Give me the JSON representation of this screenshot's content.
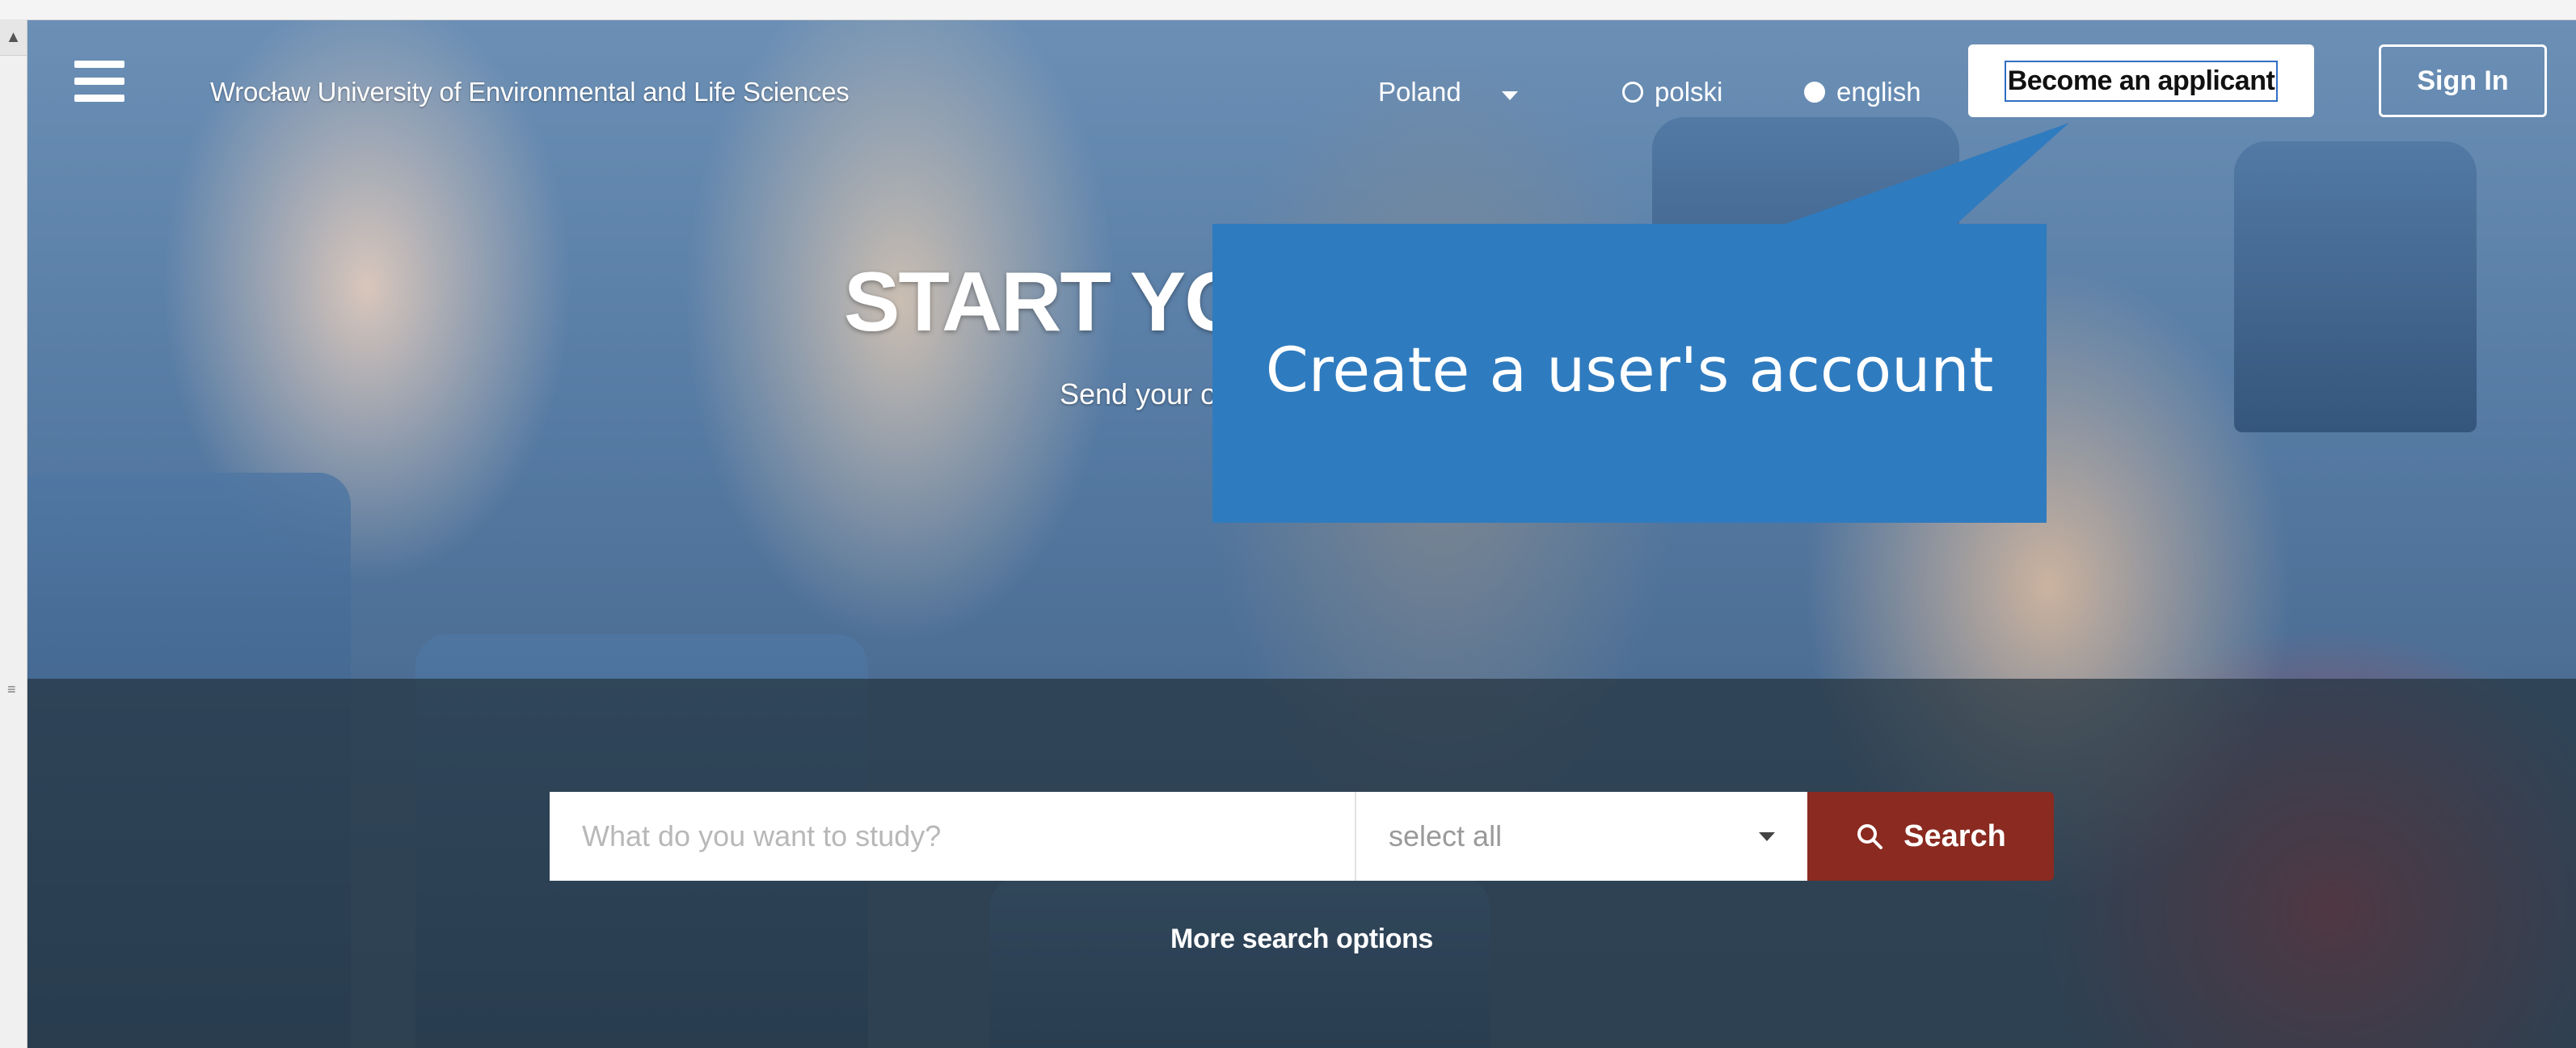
{
  "nav": {
    "university_name": "Wrocław University of Environmental and Life Sciences",
    "country": "Poland",
    "languages": [
      {
        "label": "polski",
        "selected": false
      },
      {
        "label": "english",
        "selected": true
      }
    ],
    "become_applicant_label": "Become an applicant",
    "sign_in_label": "Sign In"
  },
  "hero": {
    "title_visible": "START YO",
    "subtitle_visible": "Send your on"
  },
  "callout": {
    "text": "Create a user's account",
    "color": "#2f7bbf"
  },
  "search": {
    "placeholder": "What do you want to study?",
    "select_value": "select all",
    "button_label": "Search",
    "more_options_label": "More search options",
    "button_color": "#8a2a20"
  },
  "icons": {
    "menu": "hamburger-menu-icon",
    "search": "search-icon",
    "dropdown": "caret-down-icon"
  }
}
